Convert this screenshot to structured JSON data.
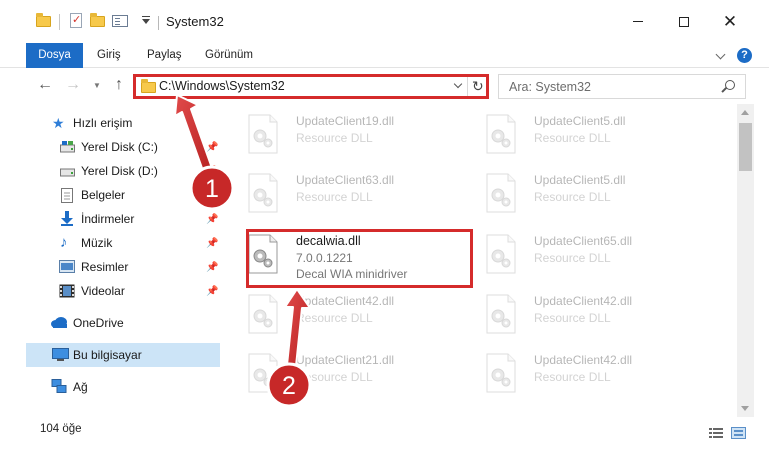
{
  "window": {
    "title": "System32"
  },
  "ribbon": {
    "tabs": [
      "Dosya",
      "Giriş",
      "Paylaş",
      "Görünüm"
    ],
    "help": "?"
  },
  "navigation": {
    "address": "C:\\Windows\\System32",
    "search_placeholder": "Ara: System32"
  },
  "sidebar": {
    "items": [
      {
        "label": "Hızlı erişim",
        "icon": "star-icon"
      },
      {
        "label": "Yerel Disk (C:)",
        "icon": "drive-icon",
        "pinned": true
      },
      {
        "label": "Yerel Disk (D:)",
        "icon": "drive-icon",
        "pinned": true
      },
      {
        "label": "Belgeler",
        "icon": "document-icon",
        "pinned": true
      },
      {
        "label": "İndirmeler",
        "icon": "download-icon",
        "pinned": true
      },
      {
        "label": "Müzik",
        "icon": "music-icon",
        "pinned": true
      },
      {
        "label": "Resimler",
        "icon": "pictures-icon",
        "pinned": true
      },
      {
        "label": "Videolar",
        "icon": "video-icon",
        "pinned": true
      },
      {
        "label": "OneDrive",
        "icon": "cloud-icon"
      },
      {
        "label": "Bu bilgisayar",
        "icon": "computer-icon",
        "selected": true
      },
      {
        "label": "Ağ",
        "icon": "network-icon"
      }
    ]
  },
  "files": {
    "left": [
      {
        "name": "UpdateClient19.dll",
        "desc": "Resource DLL"
      },
      {
        "name": "UpdateClient63.dll",
        "desc": "Resource DLL"
      },
      {
        "name": "decalwia.dll",
        "version": "7.0.0.1221",
        "desc": "Decal WIA minidriver"
      },
      {
        "name": "UpdateClient42.dll",
        "desc": "Resource DLL"
      },
      {
        "name": "UpdateClient21.dll",
        "desc": "Resource DLL"
      }
    ],
    "right": [
      {
        "name": "UpdateClient5.dll",
        "desc": "Resource DLL"
      },
      {
        "name": "UpdateClient5.dll",
        "desc": "Resource DLL"
      },
      {
        "name": "UpdateClient65.dll",
        "desc": "Resource DLL"
      },
      {
        "name": "UpdateClient42.dll",
        "desc": "Resource DLL"
      },
      {
        "name": "UpdateClient42.dll",
        "desc": "Resource DLL"
      }
    ]
  },
  "annotations": {
    "step1": "1",
    "step2": "2"
  },
  "status": {
    "item_count": "104 öğe"
  },
  "colors": {
    "accent": "#1c6cc6",
    "highlight": "#d52b2b",
    "selection": "#cce4f7"
  }
}
